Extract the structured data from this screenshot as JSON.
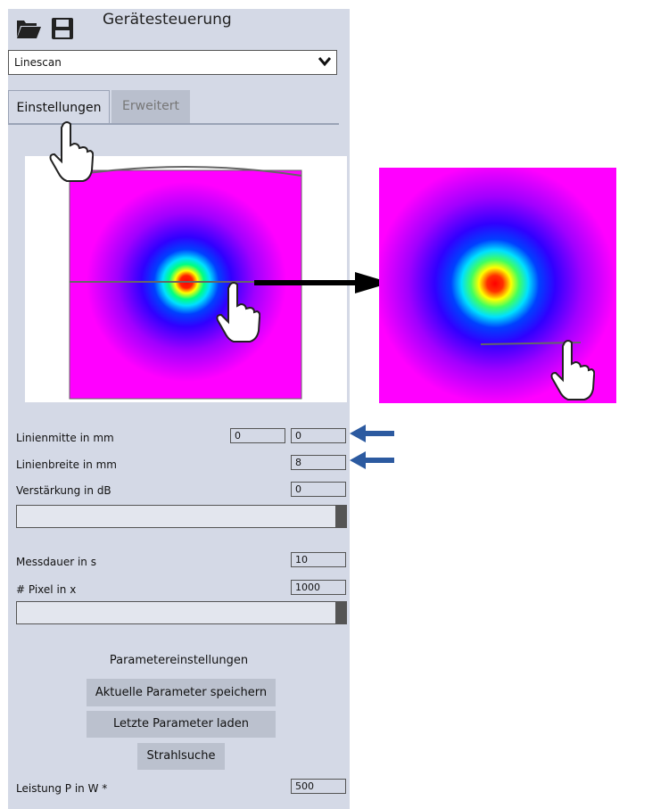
{
  "header": {
    "title": "Gerätesteuerung",
    "open_icon": "folder-open-icon",
    "save_icon": "save-icon"
  },
  "mode_select": {
    "value": "Linescan"
  },
  "tabs": [
    {
      "label": "Einstellungen",
      "active": true
    },
    {
      "label": "Erweitert",
      "active": false
    }
  ],
  "fields": {
    "linienmitte": {
      "label": "Linienmitte in mm",
      "value_a": "0",
      "value_b": "0"
    },
    "linienbreite": {
      "label": "Linienbreite in mm",
      "value": "8"
    },
    "verstaerkung": {
      "label": "Verstärkung in dB",
      "value": "0"
    },
    "messdauer": {
      "label": "Messdauer in s",
      "value": "10"
    },
    "pixel": {
      "label": "# Pixel in x",
      "value": "1000"
    },
    "leistung": {
      "label": "Leistung P in W *",
      "value": "500"
    }
  },
  "sliders": {
    "verstaerkung_level": 1.0,
    "pixel_level": 1.0
  },
  "params": {
    "section_title": "Parametereinstellungen",
    "save_label": "Aktuelle Parameter speichern",
    "load_label": "Letzte Parameter laden",
    "search_label": "Strahlsuche"
  },
  "colors": {
    "panel": "#d4d9e6",
    "tab_inactive": "#b9bfcd",
    "button": "#bbc1ce",
    "annotation_arrow": "#2c5aa0",
    "beam_background": "#ff00ff"
  }
}
